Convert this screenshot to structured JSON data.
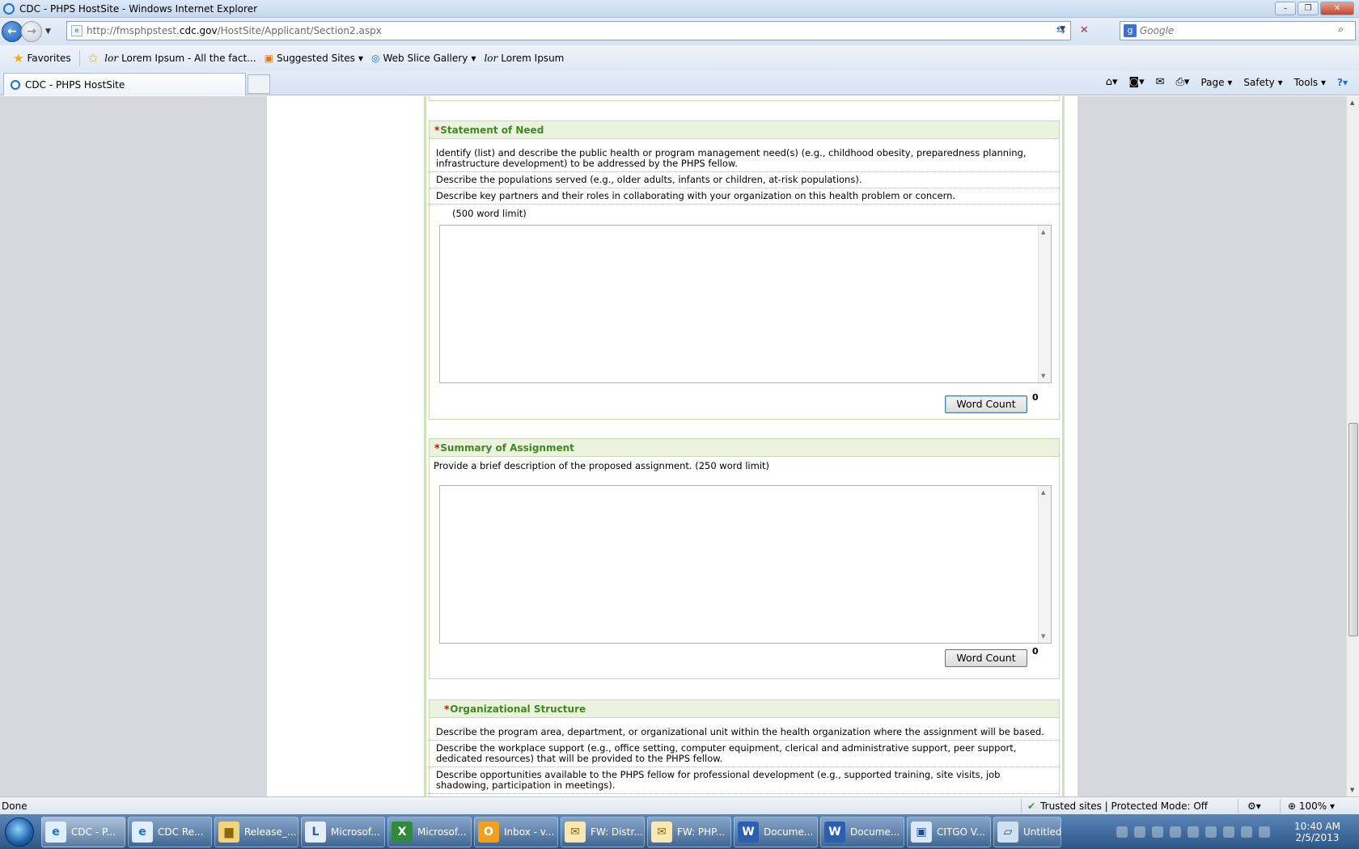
{
  "window": {
    "title": "CDC - PHPS HostSite - Windows Internet Explorer"
  },
  "address": {
    "url_prefix": "http://fmsphpstest.",
    "url_domain": "cdc.gov",
    "url_suffix": "/HostSite/Applicant/Section2.aspx",
    "search_placeholder": "Google"
  },
  "favorites": {
    "label": "Favorites",
    "items": [
      "Lorem Ipsum - All the fact...",
      "Suggested Sites",
      "Web Slice Gallery",
      "Lorem Ipsum"
    ]
  },
  "tabs": [
    {
      "label": "CDC - PHPS HostSite"
    }
  ],
  "commandbar": {
    "page": "Page",
    "safety": "Safety",
    "tools": "Tools"
  },
  "sections": {
    "statement": {
      "title": "Statement of Need",
      "lines": [
        "Identify (list) and describe the public health or program management need(s) (e.g., childhood obesity, preparedness planning, infrastructure development) to be addressed by the PHPS fellow.",
        "Describe the populations served (e.g., older adults, infants or children, at-risk populations).",
        "Describe key partners and their roles in collaborating with your organization on this health problem or concern."
      ],
      "limit": "(500 word limit)",
      "word_count_label": "Word Count",
      "word_count_value": "0"
    },
    "summary": {
      "title": "Summary of Assignment",
      "description": "Provide a brief description of the proposed assignment. (250 word limit)",
      "word_count_label": "Word Count",
      "word_count_value": "0"
    },
    "org": {
      "title": "Organizational Structure",
      "lines": [
        "Describe the program area, department, or organizational unit within the health organization where the assignment will be based.",
        "Describe the workplace support (e.g., office setting, computer equipment, clerical and administrative support, peer support, dedicated resources) that will be provided to the PHPS fellow.",
        "Describe opportunities available to the PHPS fellow for professional development (e.g., supported training, site visits, job shadowing, participation in meetings)."
      ]
    }
  },
  "status": {
    "left": "Done",
    "zone": "Trusted sites | Protected Mode: Off",
    "zoom": "100%"
  },
  "taskbar": {
    "items": [
      "CDC - P...",
      "CDC Re...",
      "Release_...",
      "Microsof...",
      "Microsof...",
      "Inbox - v...",
      "FW: Distr...",
      "FW: PHP...",
      "Docume...",
      "Docume...",
      "CITGO V...",
      "Untitled ..."
    ],
    "time": "10:40 AM",
    "date": "2/5/2013"
  }
}
